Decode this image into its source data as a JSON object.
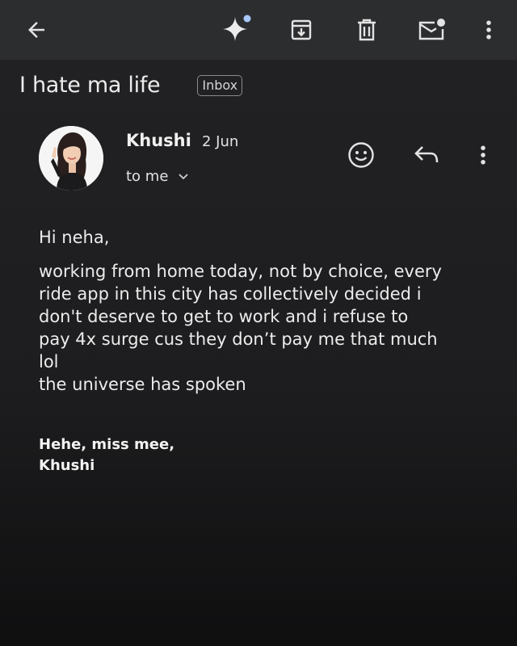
{
  "toolbar": {
    "back_icon": "arrow-left-icon",
    "gemini_icon": "sparkle-icon",
    "archive_icon": "archive-icon",
    "delete_icon": "trash-icon",
    "mark_unread_icon": "mail-unread-icon",
    "more_icon": "more-vert-icon"
  },
  "email": {
    "subject": "I hate ma life",
    "label": "Inbox",
    "sender": {
      "name": "Khushi",
      "date": "2 Jun",
      "recipient": "to me"
    },
    "actions": {
      "emoji_icon": "emoji-icon",
      "reply_icon": "reply-icon",
      "more_icon": "more-vert-icon"
    },
    "greeting": "Hi neha,",
    "body_lines": [
      "working from home today, not by choice, every",
      "ride app in this city has collectively decided i",
      "don't deserve to get to work and i refuse to",
      "pay 4x surge cus they don’t pay me that much",
      "lol",
      "the universe has spoken"
    ],
    "signature": {
      "line1": "Hehe, miss mee,",
      "line2": "Khushi"
    }
  },
  "colors": {
    "background": "#1f1f21",
    "toolbar": "#2c2d2f",
    "text": "#ececec",
    "notification_dot": "#a8c7fa"
  }
}
